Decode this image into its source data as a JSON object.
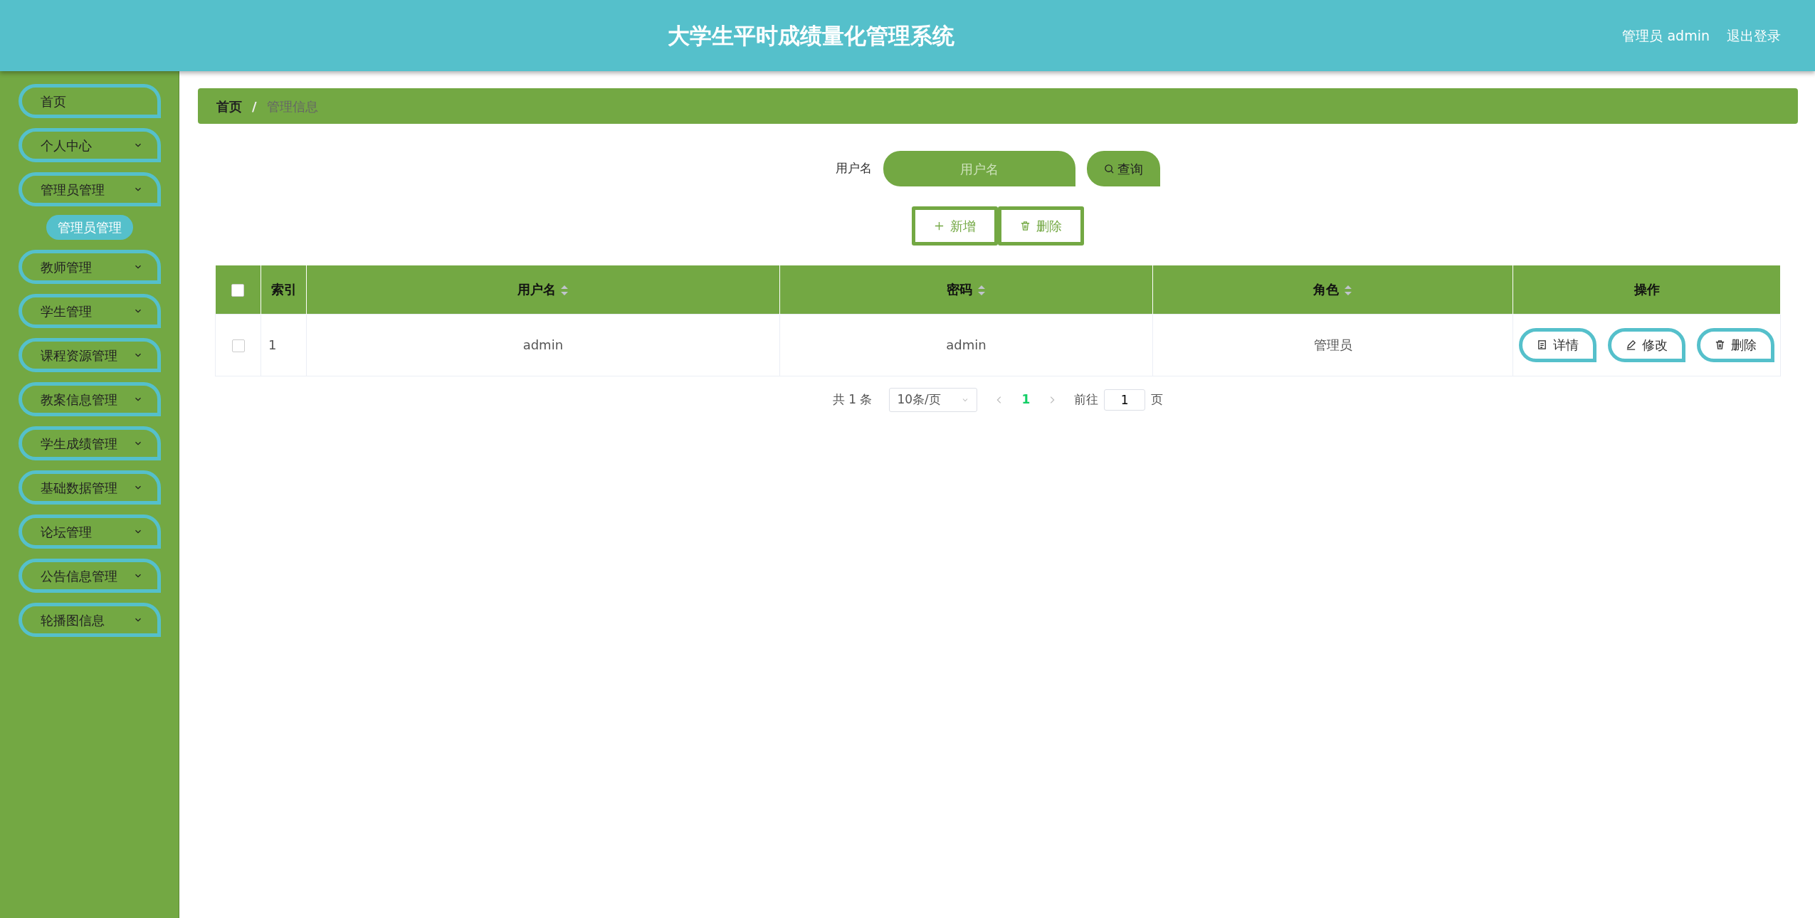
{
  "header": {
    "title": "大学生平时成绩量化管理系统",
    "user": "管理员 admin",
    "logout": "退出登录"
  },
  "sidebar": {
    "items": [
      {
        "label": "首页",
        "kind": "link"
      },
      {
        "label": "个人中心",
        "kind": "submenu"
      },
      {
        "label": "管理员管理",
        "kind": "submenu",
        "children": [
          {
            "label": "管理员管理",
            "selected": true
          }
        ]
      },
      {
        "label": "教师管理",
        "kind": "submenu"
      },
      {
        "label": "学生管理",
        "kind": "submenu"
      },
      {
        "label": "课程资源管理",
        "kind": "submenu"
      },
      {
        "label": "教案信息管理",
        "kind": "submenu"
      },
      {
        "label": "学生成绩管理",
        "kind": "submenu"
      },
      {
        "label": "基础数据管理",
        "kind": "submenu"
      },
      {
        "label": "论坛管理",
        "kind": "submenu"
      },
      {
        "label": "公告信息管理",
        "kind": "submenu"
      },
      {
        "label": "轮播图信息",
        "kind": "submenu"
      }
    ]
  },
  "breadcrumb": {
    "items": [
      "首页",
      "管理信息"
    ],
    "separator": "/"
  },
  "search": {
    "label": "用户名",
    "placeholder": "用户名",
    "button": "查询"
  },
  "actions": [
    {
      "label": "新增",
      "kind": "add"
    },
    {
      "label": "删除",
      "kind": "delete"
    }
  ],
  "table": {
    "select_all": {
      "checked": false
    },
    "columns": [
      {
        "label": "索引",
        "sortable": false
      },
      {
        "label": "用户名",
        "sortable": true
      },
      {
        "label": "密码",
        "sortable": true
      },
      {
        "label": "角色",
        "sortable": true
      },
      {
        "label": "操作",
        "sortable": false
      }
    ],
    "rows": [
      {
        "checked": false,
        "cells": [
          "1",
          "admin",
          "admin",
          "管理员"
        ],
        "buttons": [
          {
            "label": "详情",
            "kind": "detail"
          },
          {
            "label": "修改",
            "kind": "edit"
          },
          {
            "label": "删除",
            "kind": "delete"
          }
        ]
      }
    ]
  },
  "pagination": {
    "total": "共 1 条",
    "page_size": "10条/页",
    "pages": [
      {
        "label": "1",
        "selected": true
      }
    ],
    "goto_label": "前往",
    "goto_value": "1",
    "goto_suffix": "页"
  }
}
